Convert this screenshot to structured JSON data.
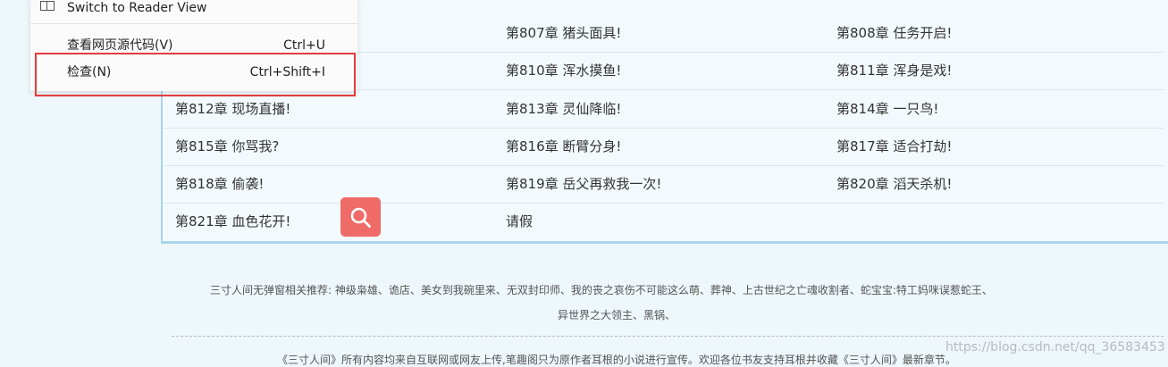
{
  "context_menu": {
    "reader_view": "Switch to Reader View",
    "view_source": "查看网页源代码(V)",
    "view_source_shortcut": "Ctrl+U",
    "inspect": "检查(N)",
    "inspect_shortcut": "Ctrl+Shift+I"
  },
  "chapters": {
    "row1": [
      "第807章 猪头面具!",
      "第808章 任务开启!"
    ],
    "row2": [
      "第810章 浑水摸鱼!",
      "第811章 浑身是戏!"
    ],
    "row3": [
      "第812章 现场直播!",
      "第813章 灵仙降临!",
      "第814章 一只鸟!"
    ],
    "row4": [
      "第815章 你骂我?",
      "第816章 断臂分身!",
      "第817章 适合打劫!"
    ],
    "row5": [
      "第818章 偷袭!",
      "第819章 岳父再救我一次!",
      "第820章 滔天杀机!"
    ],
    "row6": [
      "第821章 血色花开!",
      "请假"
    ]
  },
  "footer": {
    "related": "三寸人间无弹窗相关推荐: 神级枭雄、诡店、美女到我碗里来、无双封印师、我的丧之哀伤不可能这么萌、葬神、上古世纪之亡魂收割者、蛇宝宝:特工妈咪误惹蛇王、",
    "related2": "异世界之大领主、黑锅、",
    "copyright": "《三寸人间》所有内容均来自互联网或网友上传,笔趣阁只为原作者耳根的小说进行宣传。欢迎各位书友支持耳根并收藏《三寸人间》最新章节。",
    "watermark": "https://blog.csdn.net/qq_36583453"
  },
  "colors": {
    "menu_highlight": "#e53b3b",
    "search_button": "#ee6b68",
    "border_accent": "#a9d4ea"
  }
}
